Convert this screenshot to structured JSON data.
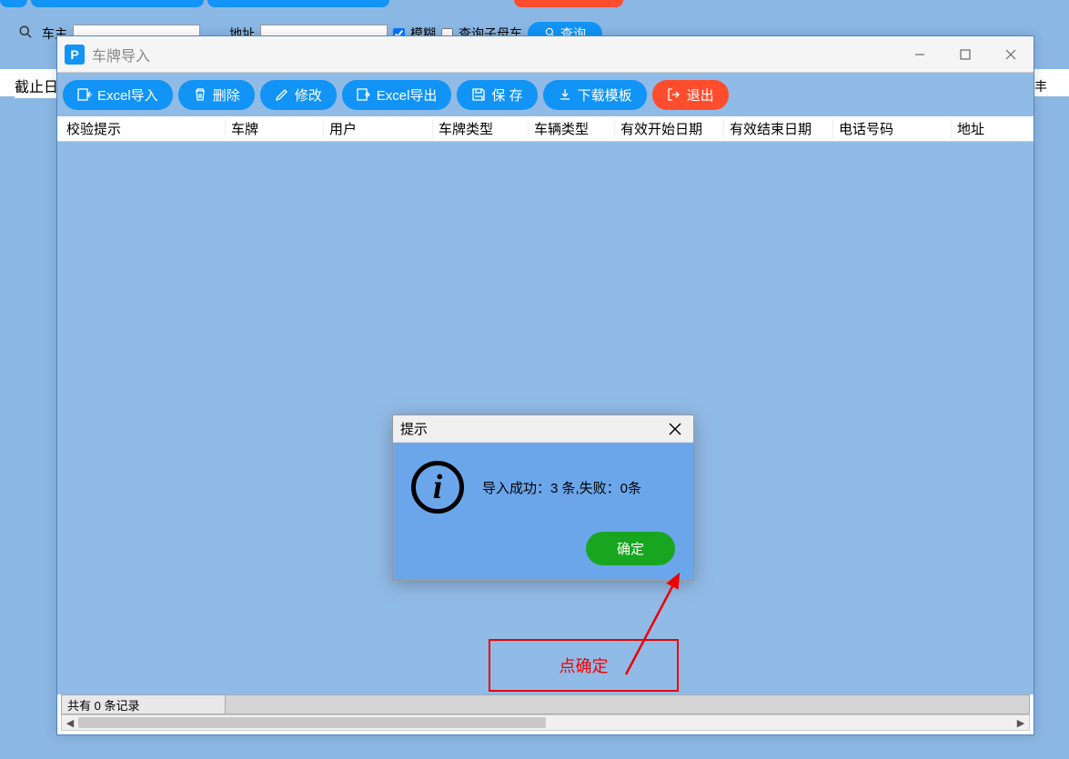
{
  "background": {
    "owner_label": "车主",
    "address_label": "地址",
    "fuzzy_label": "模糊",
    "query_sub_label": "查询子母车",
    "query_btn": "查询",
    "cutoff_label": "截止日",
    "right_marker": "丰"
  },
  "dialog": {
    "title": "车牌导入",
    "icon_letter": "P",
    "toolbar": {
      "excel_import": "Excel导入",
      "delete": "删除",
      "modify": "修改",
      "excel_export": "Excel导出",
      "save": "保 存",
      "download_template": "下载模板",
      "exit": "退出"
    },
    "columns": {
      "c0": "校验提示",
      "c1": "车牌",
      "c2": "用户",
      "c3": "车牌类型",
      "c4": "车辆类型",
      "c5": "有效开始日期",
      "c6": "有效结束日期",
      "c7": "电话号码",
      "c8": "地址"
    },
    "status": "共有 0 条记录"
  },
  "prompt": {
    "title": "提示",
    "message": "导入成功：3 条,失败：0条",
    "ok": "确定"
  },
  "annotation": {
    "text": "点确定"
  }
}
